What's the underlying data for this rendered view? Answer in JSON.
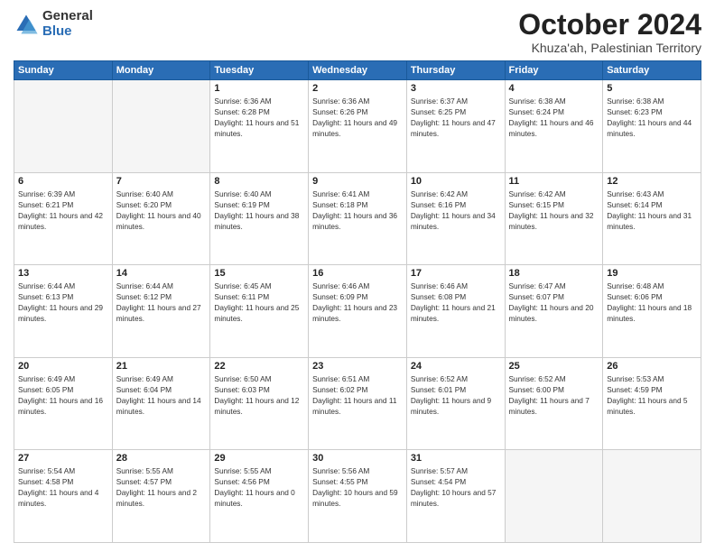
{
  "logo": {
    "general": "General",
    "blue": "Blue"
  },
  "title": "October 2024",
  "subtitle": "Khuza'ah, Palestinian Territory",
  "days_of_week": [
    "Sunday",
    "Monday",
    "Tuesday",
    "Wednesday",
    "Thursday",
    "Friday",
    "Saturday"
  ],
  "weeks": [
    [
      {
        "day": "",
        "sunrise": "",
        "sunset": "",
        "daylight": "",
        "empty": true
      },
      {
        "day": "",
        "sunrise": "",
        "sunset": "",
        "daylight": "",
        "empty": true
      },
      {
        "day": "1",
        "sunrise": "Sunrise: 6:36 AM",
        "sunset": "Sunset: 6:28 PM",
        "daylight": "Daylight: 11 hours and 51 minutes."
      },
      {
        "day": "2",
        "sunrise": "Sunrise: 6:36 AM",
        "sunset": "Sunset: 6:26 PM",
        "daylight": "Daylight: 11 hours and 49 minutes."
      },
      {
        "day": "3",
        "sunrise": "Sunrise: 6:37 AM",
        "sunset": "Sunset: 6:25 PM",
        "daylight": "Daylight: 11 hours and 47 minutes."
      },
      {
        "day": "4",
        "sunrise": "Sunrise: 6:38 AM",
        "sunset": "Sunset: 6:24 PM",
        "daylight": "Daylight: 11 hours and 46 minutes."
      },
      {
        "day": "5",
        "sunrise": "Sunrise: 6:38 AM",
        "sunset": "Sunset: 6:23 PM",
        "daylight": "Daylight: 11 hours and 44 minutes."
      }
    ],
    [
      {
        "day": "6",
        "sunrise": "Sunrise: 6:39 AM",
        "sunset": "Sunset: 6:21 PM",
        "daylight": "Daylight: 11 hours and 42 minutes."
      },
      {
        "day": "7",
        "sunrise": "Sunrise: 6:40 AM",
        "sunset": "Sunset: 6:20 PM",
        "daylight": "Daylight: 11 hours and 40 minutes."
      },
      {
        "day": "8",
        "sunrise": "Sunrise: 6:40 AM",
        "sunset": "Sunset: 6:19 PM",
        "daylight": "Daylight: 11 hours and 38 minutes."
      },
      {
        "day": "9",
        "sunrise": "Sunrise: 6:41 AM",
        "sunset": "Sunset: 6:18 PM",
        "daylight": "Daylight: 11 hours and 36 minutes."
      },
      {
        "day": "10",
        "sunrise": "Sunrise: 6:42 AM",
        "sunset": "Sunset: 6:16 PM",
        "daylight": "Daylight: 11 hours and 34 minutes."
      },
      {
        "day": "11",
        "sunrise": "Sunrise: 6:42 AM",
        "sunset": "Sunset: 6:15 PM",
        "daylight": "Daylight: 11 hours and 32 minutes."
      },
      {
        "day": "12",
        "sunrise": "Sunrise: 6:43 AM",
        "sunset": "Sunset: 6:14 PM",
        "daylight": "Daylight: 11 hours and 31 minutes."
      }
    ],
    [
      {
        "day": "13",
        "sunrise": "Sunrise: 6:44 AM",
        "sunset": "Sunset: 6:13 PM",
        "daylight": "Daylight: 11 hours and 29 minutes."
      },
      {
        "day": "14",
        "sunrise": "Sunrise: 6:44 AM",
        "sunset": "Sunset: 6:12 PM",
        "daylight": "Daylight: 11 hours and 27 minutes."
      },
      {
        "day": "15",
        "sunrise": "Sunrise: 6:45 AM",
        "sunset": "Sunset: 6:11 PM",
        "daylight": "Daylight: 11 hours and 25 minutes."
      },
      {
        "day": "16",
        "sunrise": "Sunrise: 6:46 AM",
        "sunset": "Sunset: 6:09 PM",
        "daylight": "Daylight: 11 hours and 23 minutes."
      },
      {
        "day": "17",
        "sunrise": "Sunrise: 6:46 AM",
        "sunset": "Sunset: 6:08 PM",
        "daylight": "Daylight: 11 hours and 21 minutes."
      },
      {
        "day": "18",
        "sunrise": "Sunrise: 6:47 AM",
        "sunset": "Sunset: 6:07 PM",
        "daylight": "Daylight: 11 hours and 20 minutes."
      },
      {
        "day": "19",
        "sunrise": "Sunrise: 6:48 AM",
        "sunset": "Sunset: 6:06 PM",
        "daylight": "Daylight: 11 hours and 18 minutes."
      }
    ],
    [
      {
        "day": "20",
        "sunrise": "Sunrise: 6:49 AM",
        "sunset": "Sunset: 6:05 PM",
        "daylight": "Daylight: 11 hours and 16 minutes."
      },
      {
        "day": "21",
        "sunrise": "Sunrise: 6:49 AM",
        "sunset": "Sunset: 6:04 PM",
        "daylight": "Daylight: 11 hours and 14 minutes."
      },
      {
        "day": "22",
        "sunrise": "Sunrise: 6:50 AM",
        "sunset": "Sunset: 6:03 PM",
        "daylight": "Daylight: 11 hours and 12 minutes."
      },
      {
        "day": "23",
        "sunrise": "Sunrise: 6:51 AM",
        "sunset": "Sunset: 6:02 PM",
        "daylight": "Daylight: 11 hours and 11 minutes."
      },
      {
        "day": "24",
        "sunrise": "Sunrise: 6:52 AM",
        "sunset": "Sunset: 6:01 PM",
        "daylight": "Daylight: 11 hours and 9 minutes."
      },
      {
        "day": "25",
        "sunrise": "Sunrise: 6:52 AM",
        "sunset": "Sunset: 6:00 PM",
        "daylight": "Daylight: 11 hours and 7 minutes."
      },
      {
        "day": "26",
        "sunrise": "Sunrise: 5:53 AM",
        "sunset": "Sunset: 4:59 PM",
        "daylight": "Daylight: 11 hours and 5 minutes."
      }
    ],
    [
      {
        "day": "27",
        "sunrise": "Sunrise: 5:54 AM",
        "sunset": "Sunset: 4:58 PM",
        "daylight": "Daylight: 11 hours and 4 minutes."
      },
      {
        "day": "28",
        "sunrise": "Sunrise: 5:55 AM",
        "sunset": "Sunset: 4:57 PM",
        "daylight": "Daylight: 11 hours and 2 minutes."
      },
      {
        "day": "29",
        "sunrise": "Sunrise: 5:55 AM",
        "sunset": "Sunset: 4:56 PM",
        "daylight": "Daylight: 11 hours and 0 minutes."
      },
      {
        "day": "30",
        "sunrise": "Sunrise: 5:56 AM",
        "sunset": "Sunset: 4:55 PM",
        "daylight": "Daylight: 10 hours and 59 minutes."
      },
      {
        "day": "31",
        "sunrise": "Sunrise: 5:57 AM",
        "sunset": "Sunset: 4:54 PM",
        "daylight": "Daylight: 10 hours and 57 minutes."
      },
      {
        "day": "",
        "sunrise": "",
        "sunset": "",
        "daylight": "",
        "empty": true
      },
      {
        "day": "",
        "sunrise": "",
        "sunset": "",
        "daylight": "",
        "empty": true
      }
    ]
  ]
}
